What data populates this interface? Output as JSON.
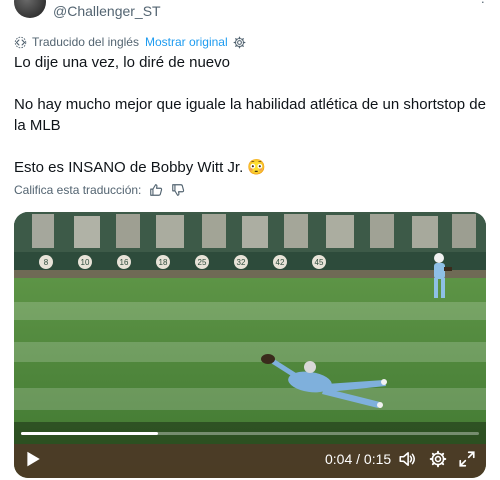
{
  "author": {
    "handle": "@Challenger_ST"
  },
  "translation": {
    "label": "Traducido del inglés",
    "show_original": "Mostrar original"
  },
  "tweet": {
    "line1": "Lo dije una vez, lo diré de nuevo",
    "line2": "No hay mucho mejor que iguale la habilidad atlética de un shortstop de la MLB",
    "line3": "Esto es INSANO de Bobby Witt Jr. 😳"
  },
  "rate": {
    "label": "Califica esta traducción:"
  },
  "video": {
    "time": "0:04 / 0:15",
    "progress": 0.3,
    "wall_numbers": [
      "8",
      "10",
      "16",
      "18",
      "25",
      "32",
      "42",
      "45"
    ]
  },
  "colors": {
    "accent": "#1d9bf0",
    "grass": "#4f8a3a",
    "jersey": "#7fb0dc",
    "wall": "#2e4a3a"
  }
}
